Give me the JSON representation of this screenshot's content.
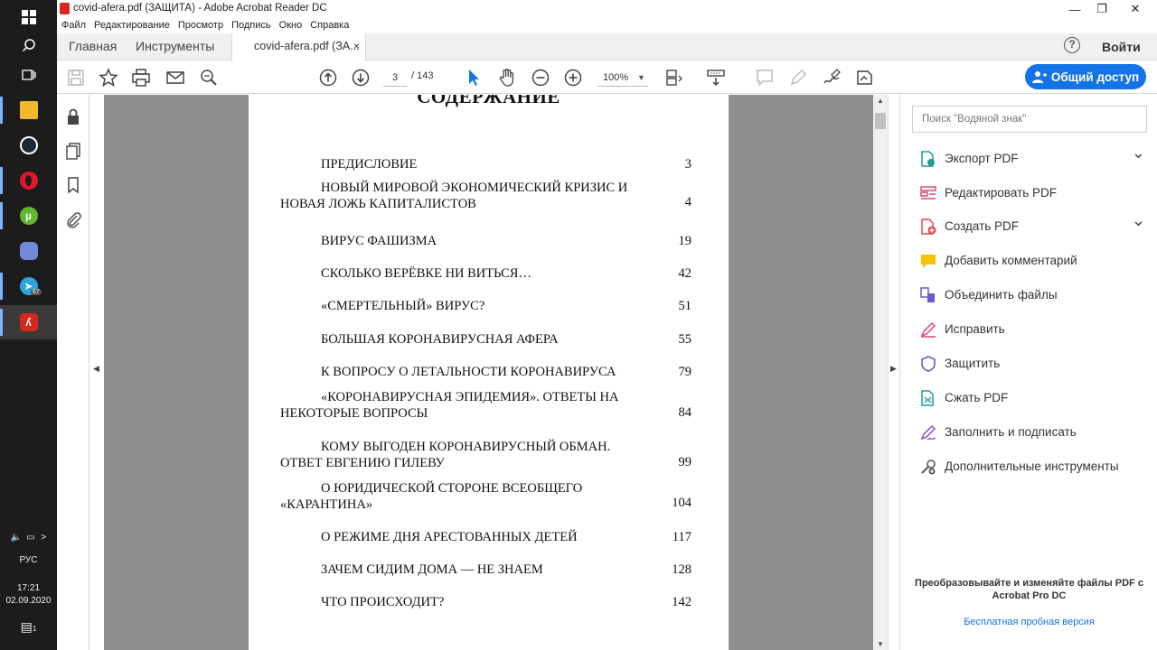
{
  "window": {
    "title": "covid-afera.pdf (ЗАЩИТА) - Adobe Acrobat Reader DC",
    "minimize": "—",
    "maximize": "❐",
    "close": "✕"
  },
  "menu": [
    "Файл",
    "Редактирование",
    "Просмотр",
    "Подпись",
    "Окно",
    "Справка"
  ],
  "tabs": {
    "home": "Главная",
    "tools": "Инструменты",
    "document": "covid-afera.pdf (ЗА...",
    "close": "×"
  },
  "header": {
    "help": "?",
    "signin": "Войти"
  },
  "toolbar": {
    "current_page": "3",
    "page_total": "/ 143",
    "zoom": "100%",
    "share_label": "Общий доступ"
  },
  "document": {
    "heading": "СОДЕРЖАНИЕ",
    "toc": [
      {
        "title": "ПРЕДИСЛОВИЕ",
        "page": "3"
      },
      {
        "title": "НОВЫЙ МИРОВОЙ ЭКОНОМИЧЕСКИЙ КРИЗИС И НОВАЯ ЛОЖЬ КАПИТАЛИСТОВ",
        "page": "4"
      },
      {
        "title": "ВИРУС ФАШИЗМА",
        "page": "19"
      },
      {
        "title": "СКОЛЬКО ВЕРЁВКЕ НИ ВИТЬСЯ…",
        "page": "42"
      },
      {
        "title": "«СМЕРТЕЛЬНЫЙ» ВИРУС?",
        "page": "51"
      },
      {
        "title": "БОЛЬШАЯ КОРОНАВИРУСНАЯ АФЕРА",
        "page": "55"
      },
      {
        "title": "К ВОПРОСУ О ЛЕТАЛЬНОСТИ КОРОНАВИРУСА",
        "page": "79"
      },
      {
        "title": "«КОРОНАВИРУСНАЯ ЭПИДЕМИЯ». ОТВЕТЫ НА НЕКОТОРЫЕ ВОПРОСЫ",
        "page": "84"
      },
      {
        "title": "КОМУ ВЫГОДЕН КОРОНАВИРУСНЫЙ ОБМАН. ОТВЕТ ЕВГЕНИЮ ГИЛЕВУ",
        "page": "99"
      },
      {
        "title": "О ЮРИДИЧЕСКОЙ СТОРОНЕ ВСЕОБЩЕГО «КАРАНТИНА»",
        "page": "104"
      },
      {
        "title": "О РЕЖИМЕ ДНЯ АРЕСТОВАННЫХ ДЕТЕЙ",
        "page": "117"
      },
      {
        "title": "ЗАЧЕМ СИДИМ ДОМА — НЕ ЗНАЕМ",
        "page": "128"
      },
      {
        "title": "ЧТО ПРОИСХОДИТ?",
        "page": "142"
      }
    ]
  },
  "right_pane": {
    "search_placeholder": "Поиск \"Водяной знак\"",
    "tools": [
      {
        "label": "Экспорт PDF",
        "icon": "export-pdf-icon",
        "color": "#1a9e8f",
        "expandable": true
      },
      {
        "label": "Редактировать PDF",
        "icon": "edit-pdf-icon",
        "color": "#e0457b",
        "expandable": false
      },
      {
        "label": "Создать PDF",
        "icon": "create-pdf-icon",
        "color": "#e34850",
        "expandable": true
      },
      {
        "label": "Добавить комментарий",
        "icon": "comment-icon",
        "color": "#f5c400",
        "expandable": false
      },
      {
        "label": "Объединить файлы",
        "icon": "combine-files-icon",
        "color": "#6a5acd",
        "expandable": false
      },
      {
        "label": "Исправить",
        "icon": "fill-fix-icon",
        "color": "#e0457b",
        "expandable": false
      },
      {
        "label": "Защитить",
        "icon": "protect-shield-icon",
        "color": "#5b5fc7",
        "expandable": false
      },
      {
        "label": "Сжать PDF",
        "icon": "compress-pdf-icon",
        "color": "#1a9e8f",
        "expandable": false
      },
      {
        "label": "Заполнить и подписать",
        "icon": "fill-sign-icon",
        "color": "#8a4fd1",
        "expandable": false
      },
      {
        "label": "Дополнительные инструменты",
        "icon": "more-tools-icon",
        "color": "#555555",
        "expandable": false
      }
    ],
    "promo": "Преобразовывайте и изменяйте файлы PDF с Acrobat Pro DC",
    "trial_link": "Бесплатная пробная версия"
  },
  "taskbar": {
    "language": "РУС",
    "time": "17:21",
    "date": "02.09.2020",
    "telegram_badge": "67",
    "notifications": "1"
  },
  "colors": {
    "accent": "#1473e6",
    "viewport_bg": "#8f8f8f",
    "taskbar_bg": "#1c1c1c"
  }
}
